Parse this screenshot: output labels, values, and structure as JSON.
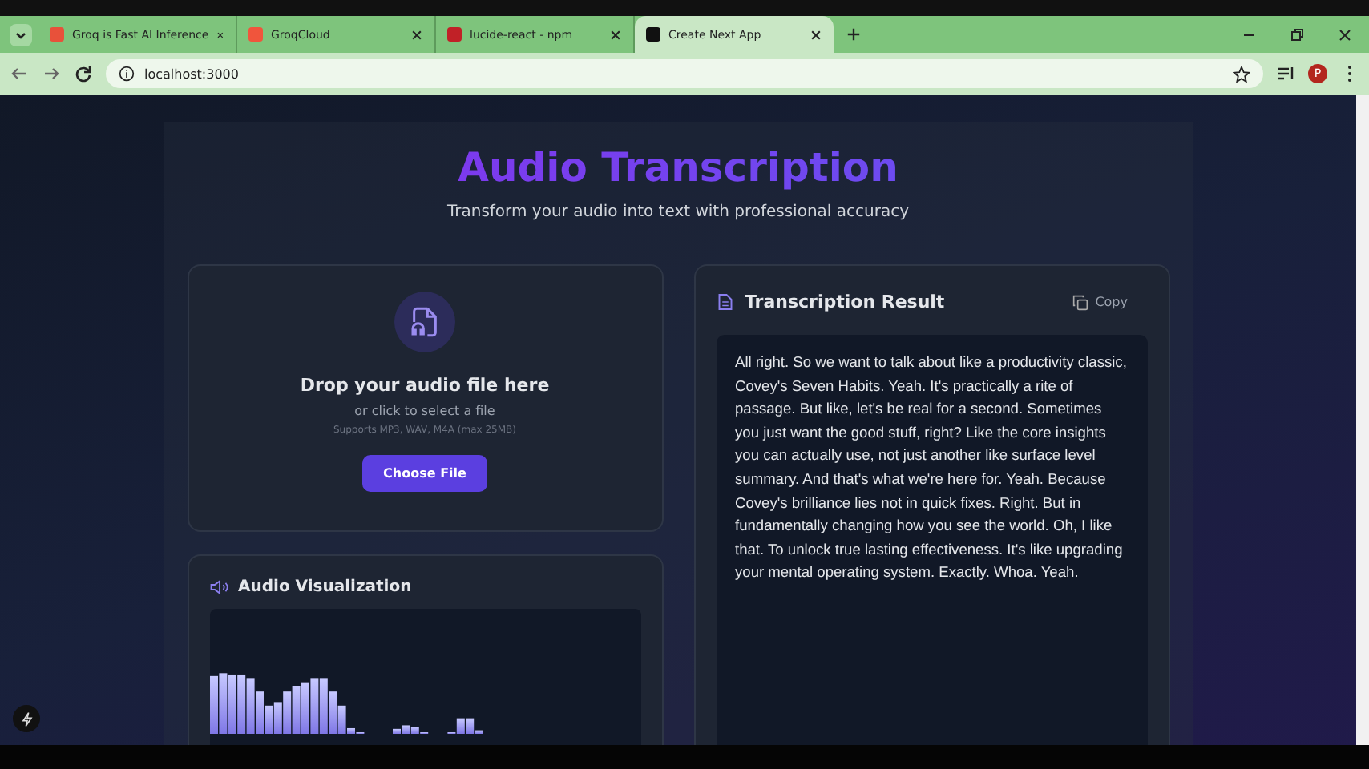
{
  "browser": {
    "tabs": [
      {
        "title": "Groq is Fast AI Inference",
        "color": "#e8513a",
        "selected": false
      },
      {
        "title": "GroqCloud",
        "color": "#f0553c",
        "selected": false
      },
      {
        "title": "lucide-react - npm",
        "color": "#c12127",
        "selected": false
      },
      {
        "title": "Create Next App",
        "color": "#111111",
        "selected": true
      }
    ],
    "address": "localhost:3000",
    "profile": "P"
  },
  "page": {
    "title": "Audio Transcription",
    "subtitle": "Transform your audio into text with professional accuracy",
    "upload": {
      "heading": "Drop your audio file here",
      "hint": "or click to select a file",
      "formats": "Supports MP3, WAV, M4A (max 25MB)",
      "button": "Choose File"
    },
    "visualization": {
      "title": "Audio Visualization"
    },
    "result": {
      "title": "Transcription Result",
      "copy": "Copy",
      "text": " All right. So we want to talk about like a productivity classic, Covey's Seven Habits. Yeah. It's practically a rite of passage. But like, let's be real for a second. Sometimes you just want the good stuff, right? Like the core insights you can actually use, not just another like surface level summary. And that's what we're here for. Yeah. Because Covey's brilliance lies not in quick fixes. Right. But in fundamentally changing how you see the world. Oh, I like that. To unlock true lasting effectiveness. It's like upgrading your mental operating system. Exactly. Whoa. Yeah."
    }
  }
}
